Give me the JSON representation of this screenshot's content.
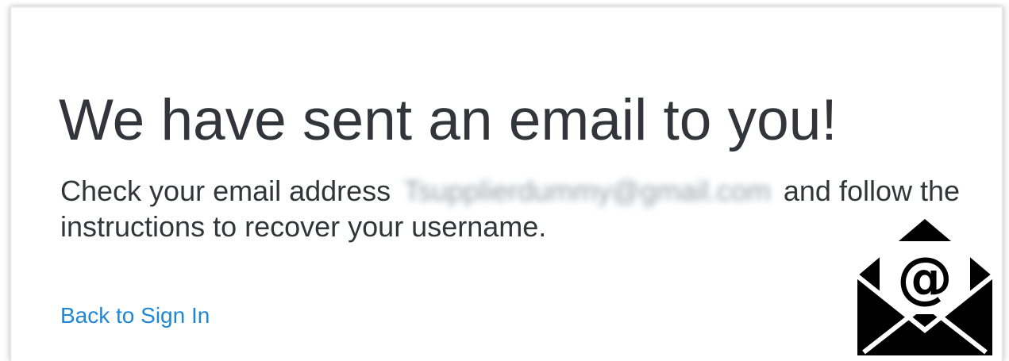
{
  "dialog": {
    "heading": "We have sent an email to you!",
    "message_before": "Check your email address ",
    "email": "Tsupplierdummy@gmail.com",
    "message_after": " and follow the instructions to recover your username.",
    "back_link": "Back to Sign In"
  },
  "icons": {
    "mail": "envelope-at-icon"
  },
  "colors": {
    "text": "#32363a",
    "link": "#1f86d3"
  }
}
